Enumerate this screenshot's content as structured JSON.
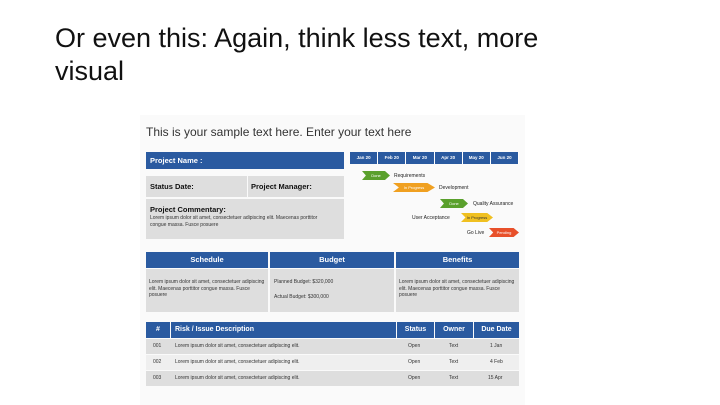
{
  "slide": {
    "title_line1": "Or even this: Again, think less text, more",
    "title_line2": "visual",
    "subtitle": "This is your sample text here. Enter your text here"
  },
  "project": {
    "name_label": "Project Name :",
    "status_date_label": "Status Date:",
    "manager_label": "Project Manager:",
    "commentary_label": "Project Commentary:",
    "commentary_text": "Lorem ipsum dolor sit amet, consectetuer adipiscing elit. Maecenas porttitor congue massa. Fusce posuere"
  },
  "timeline": {
    "months": [
      "Jan 20",
      "Feb 20",
      "Mar 20",
      "Apr 20",
      "May 20",
      "Jun 20"
    ],
    "milestones": [
      {
        "label": "Requirements",
        "badge": "Done",
        "color": "#5aa02c"
      },
      {
        "label": "Development",
        "badge": "In Progress",
        "color": "#f0a020"
      },
      {
        "label": "Quality Assurance",
        "badge": "Done",
        "color": "#5aa02c"
      },
      {
        "label": "User Acceptance",
        "badge": "In Progress",
        "color": "#f0c020"
      },
      {
        "label": "Go Live",
        "badge": "Pending",
        "color": "#e8502a"
      }
    ]
  },
  "summary": {
    "headers": [
      "Schedule",
      "Budget",
      "Benefits"
    ],
    "schedule_text": "Lorem ipsum dolor sit amet, consectetuer adipiscing elit. Maecenas porttitor congue massa. Fusce posuere",
    "planned_budget": "Planned Budget: $320,000",
    "actual_budget": "Actual Budget: $300,000",
    "benefits_text": "Lorem ipsum dolor sit amet, consectetuer adipiscing elit. Maecenas porttitor congue massa. Fusce posuere"
  },
  "risk_table": {
    "headers": [
      "#",
      "Risk / Issue Description",
      "Status",
      "Owner",
      "Due Date"
    ],
    "rows": [
      {
        "num": "001",
        "desc": "Lorem ipsum dolor sit amet, consectetuer adipiscing elit.",
        "status": "Open",
        "owner": "Text",
        "due": "1 Jan"
      },
      {
        "num": "002",
        "desc": "Lorem ipsum dolor sit amet, consectetuer adipiscing elit.",
        "status": "Open",
        "owner": "Text",
        "due": "4 Feb"
      },
      {
        "num": "003",
        "desc": "Lorem ipsum dolor sit amet, consectetuer adipiscing elit.",
        "status": "Open",
        "owner": "Text",
        "due": "15 Apr"
      }
    ]
  },
  "colors": {
    "header_blue": "#2a5aa0",
    "panel_grey": "#dedede"
  }
}
